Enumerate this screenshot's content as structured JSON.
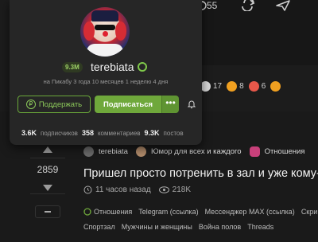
{
  "top": {
    "stat_count": "55"
  },
  "reactions": [
    {
      "icon": "wolf-emoji",
      "count": "17",
      "color": "#d9d9d9"
    },
    {
      "icon": "face-emoji",
      "count": "8",
      "color": "#f0a020"
    },
    {
      "icon": "clown-emoji",
      "count": "6",
      "color": "#e8584a"
    },
    {
      "icon": "hand-emoji",
      "count": "",
      "color": "#f0a020"
    }
  ],
  "profile": {
    "rating": "9.3M",
    "username": "terebiata",
    "since": "на Пикабу 3 года 10 месяцев 1 неделю 4 дня",
    "support_label": "Поддержать",
    "subscribe_label": "Подписаться",
    "more_label": "•••",
    "counts": {
      "subscribers_value": "3.6K",
      "subscribers_label": "подписчиков",
      "comments_value": "358",
      "comments_label": "комментариев",
      "posts_value": "9.3K",
      "posts_label": "постов"
    }
  },
  "post": {
    "votes": "2859",
    "author": "terebiata",
    "community": "Юмор для всех и каждого",
    "category": "Отношения",
    "title": "Пришел просто потренить в зал и уже кому-то",
    "time": "11 часов назад",
    "views": "218K",
    "tags_row1": [
      "Отношения",
      "Telegram (ссылка)",
      "Мессенджер MAX (ссылка)",
      "Скри"
    ],
    "tags_row2": [
      "Спортзал",
      "Мужчины и женщины",
      "Война полов",
      "Threads"
    ]
  },
  "colors": {
    "accent": "#6fa83b",
    "card_bg": "#262626",
    "page_bg": "#1a1a1a"
  }
}
